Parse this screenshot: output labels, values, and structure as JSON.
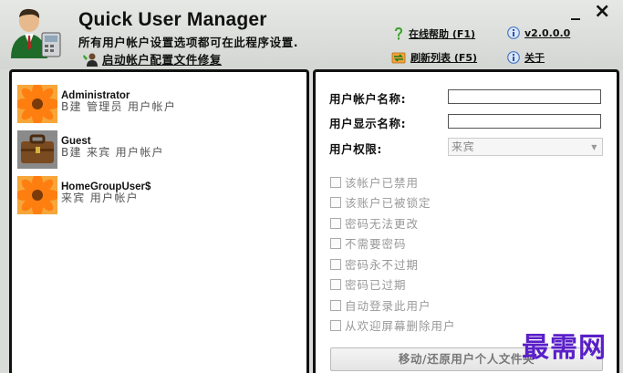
{
  "app": {
    "title": "Quick User Manager",
    "subtitle": "所有用户帐户设置选项都可在此程序设置.",
    "fix_profile_link": "启动帐户配置文件修复",
    "help_link": "在线帮助 (F1)",
    "version_link": "v2.0.0.0",
    "refresh_link": "刷新列表 (F5)",
    "about_link": "关于",
    "minimize_glyph": "_",
    "close_glyph": "×"
  },
  "users": [
    {
      "name": "Administrator",
      "description": "B建 管理员 用户帐户",
      "avatar": "flower-icon"
    },
    {
      "name": "Guest",
      "description": "B建 来宾 用户帐户",
      "avatar": "briefcase-icon"
    },
    {
      "name": "HomeGroupUser$",
      "description": "来宾 用户帐户",
      "avatar": "flower-icon"
    }
  ],
  "form": {
    "account_name_label": "用户帐户名称:",
    "account_name_value": "",
    "display_name_label": "用户显示名称:",
    "display_name_value": "",
    "permission_label": "用户权限:",
    "permission_value": "来宾",
    "checkboxes": [
      {
        "label": "该帐户已禁用",
        "checked": false
      },
      {
        "label": "该账户已被锁定",
        "checked": false
      },
      {
        "label": "密码无法更改",
        "checked": false
      },
      {
        "label": "不需要密码",
        "checked": false
      },
      {
        "label": "密码永不过期",
        "checked": false
      },
      {
        "label": "密码已过期",
        "checked": false
      },
      {
        "label": "自动登录此用户",
        "checked": false
      },
      {
        "label": "从欢迎屏幕删除用户",
        "checked": false
      }
    ],
    "move_button": "移动/还原用户个人文件夹"
  },
  "watermark": "最需网",
  "colors": {
    "accent_link": "#111111",
    "watermark": "#5a1fc8",
    "help_icon": "#3aa32a"
  }
}
